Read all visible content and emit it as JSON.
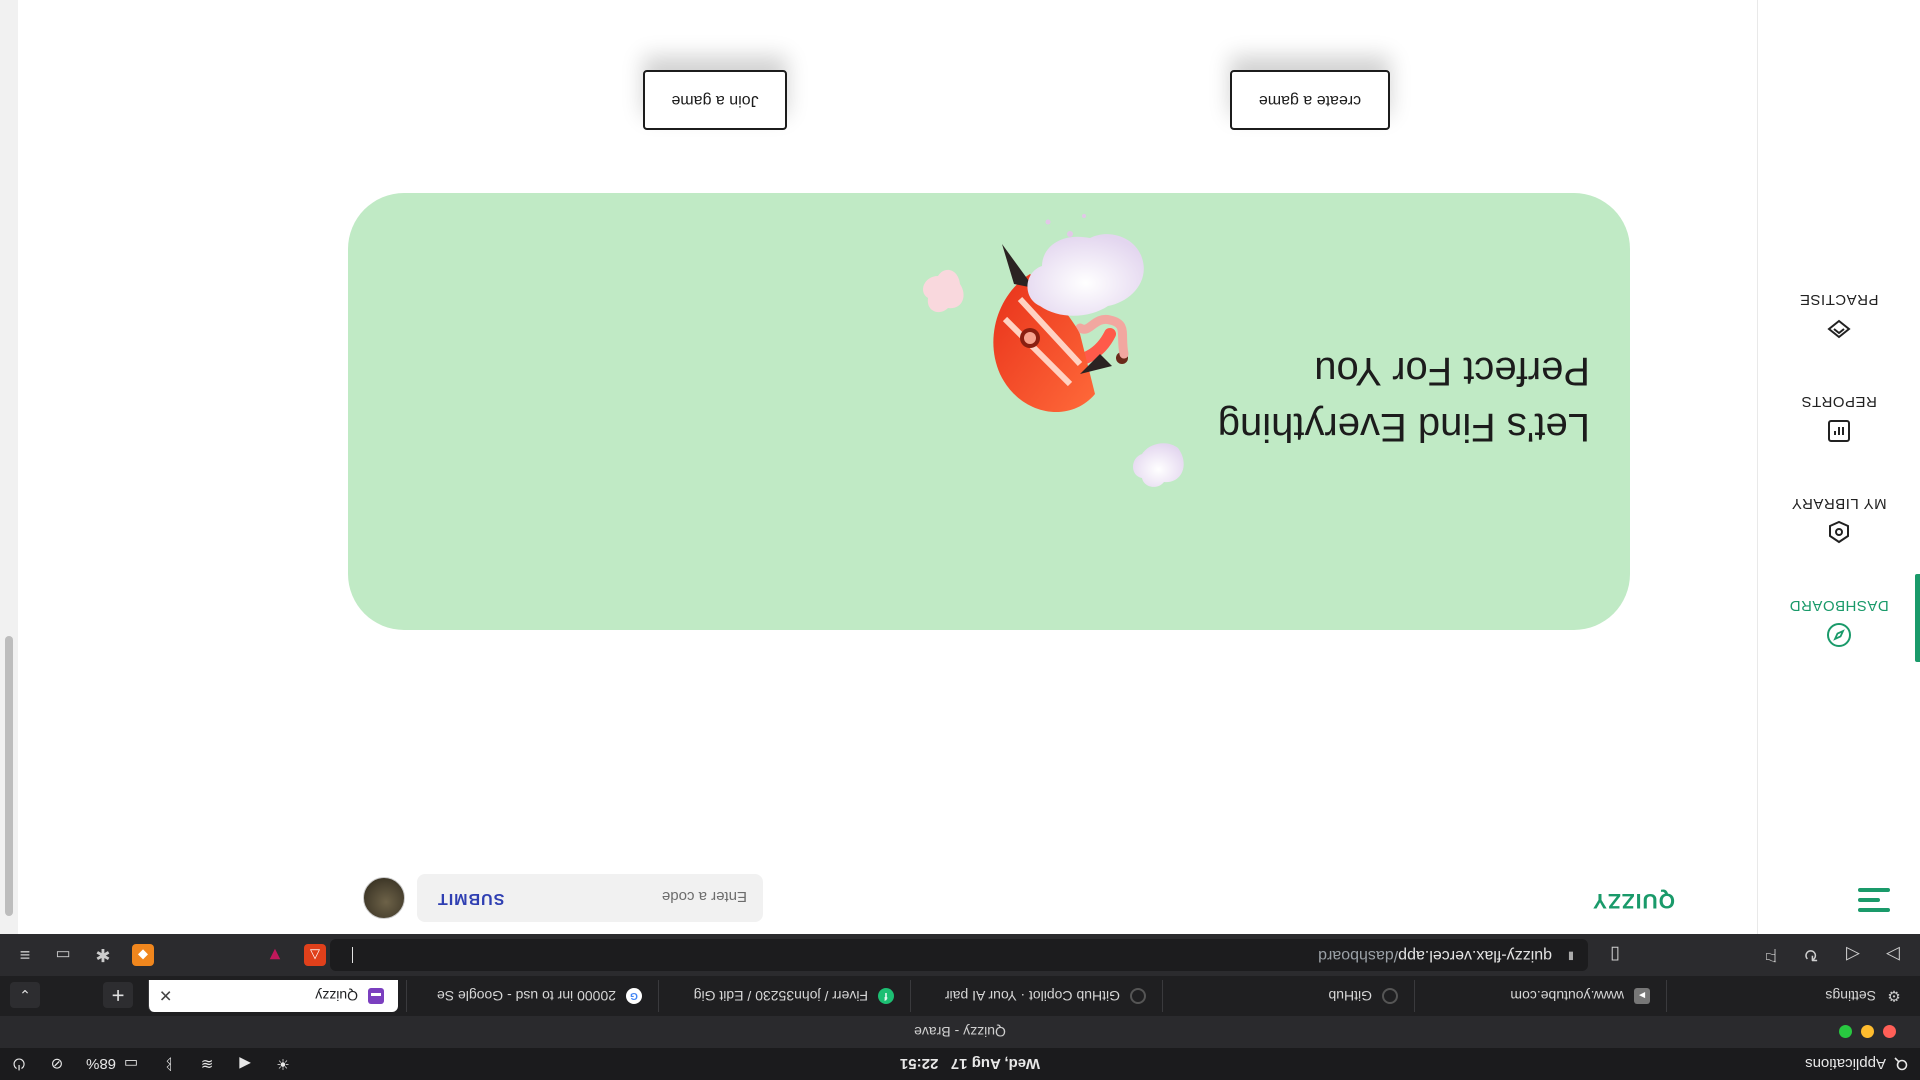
{
  "os_bar": {
    "menu_label": "Applications",
    "datetime": "Wed, Aug 17   22:51",
    "battery": "68%"
  },
  "window": {
    "title": "Quizzy - Brave",
    "colors": {
      "close": "#ff5f57",
      "minimize": "#febc2e",
      "maximize": "#28c840"
    }
  },
  "tabs": [
    {
      "label": "Settings",
      "icon": "gear-icon"
    },
    {
      "label": "www.youtube.com",
      "icon": "youtube-icon"
    },
    {
      "label": "GitHub",
      "icon": "loading-icon"
    },
    {
      "label": "GitHub Copilot · Your AI pair",
      "icon": "loading-icon"
    },
    {
      "label": "Fiverr / john35230 / Edit Gig",
      "icon": "fiverr-icon"
    },
    {
      "label": "20000 inr to usd - Google Se",
      "icon": "google-icon"
    },
    {
      "label": "Quizzy",
      "icon": "quizzy-icon",
      "active": true
    }
  ],
  "address_bar": {
    "host": "quizzy-flax.vercel.app",
    "path": "/dashboard"
  },
  "app": {
    "logo": "QUIZZY",
    "brand_color": "#1a9a6a",
    "code_input": {
      "placeholder": "Enter a code",
      "value": ""
    },
    "submit_label": "SUBMIT",
    "sidebar": [
      {
        "label": "DASHBOARD",
        "icon": "compass-icon",
        "active": true
      },
      {
        "label": "MY LIBRARY",
        "icon": "library-icon",
        "active": false
      },
      {
        "label": "REPORTS",
        "icon": "reports-icon",
        "active": false
      },
      {
        "label": "PRACTISE",
        "icon": "practise-icon",
        "active": false
      }
    ],
    "hero": {
      "title_line1": "Let's Find Everything",
      "title_line2": "Perfect For You",
      "background": "#c0eac5"
    },
    "buttons": {
      "create": "create a game",
      "join": "Join a game"
    }
  }
}
